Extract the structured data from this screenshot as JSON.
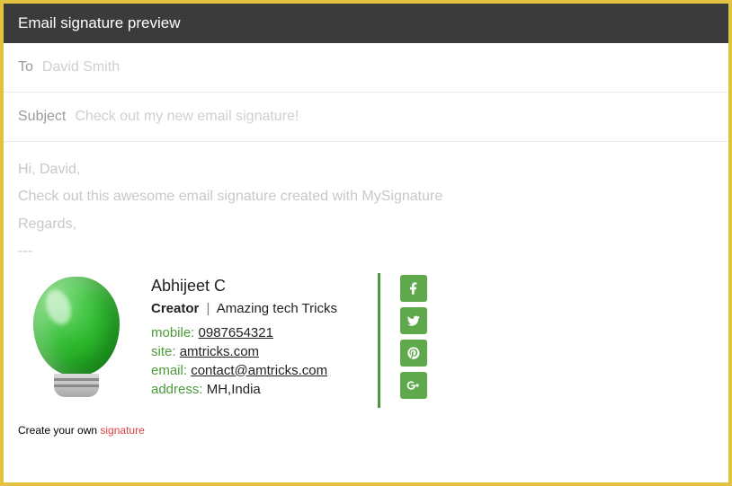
{
  "header": {
    "title": "Email signature preview"
  },
  "fields": {
    "to_label": "To",
    "to_value": "David Smith",
    "subject_label": "Subject",
    "subject_value": "Check out my new email signature!"
  },
  "body": {
    "line1": "Hi, David,",
    "line2": "Check out this awesome email signature created with MySignature",
    "line3": "Regards,",
    "line4": "---"
  },
  "signature": {
    "name": "Abhijeet C",
    "role": "Creator",
    "separator": "|",
    "company": "Amazing tech Tricks",
    "mobile_label": "mobile:",
    "mobile_value": "0987654321",
    "site_label": "site:",
    "site_value": "amtricks.com",
    "email_label": "email:",
    "email_value": "contact@amtricks.com",
    "address_label": "address:",
    "address_value": "MH,India"
  },
  "social": {
    "facebook": "facebook-icon",
    "twitter": "twitter-icon",
    "pinterest": "pinterest-icon",
    "googleplus": "googleplus-icon"
  },
  "footer": {
    "text": "Create your own ",
    "link": "signature"
  }
}
